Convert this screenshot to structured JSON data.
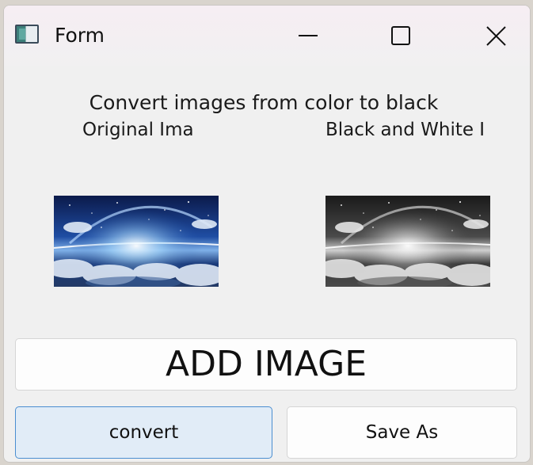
{
  "window": {
    "title": "Form",
    "icon": "app-window-icon",
    "controls": [
      "minimize-icon",
      "maximize-icon",
      "close-icon"
    ]
  },
  "content": {
    "heading": "Convert images from color to black",
    "original_label": "Original Ima",
    "bw_label": "Black and White I"
  },
  "images": {
    "original": "space scene with clouds and galaxy (color)",
    "bw": "space scene with clouds and galaxy (grayscale)"
  },
  "buttons": {
    "add_image": "ADD IMAGE",
    "convert": "convert",
    "save_as": "Save As"
  },
  "colors": {
    "convert_focus_border": "#4b8ed0",
    "convert_focus_bg": "#e1ecf7"
  }
}
